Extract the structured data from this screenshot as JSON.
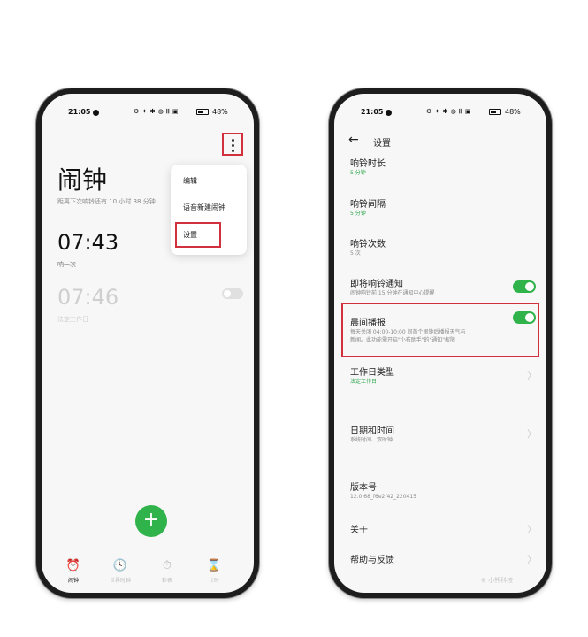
{
  "status_bar": {
    "time": "21:05",
    "icons": "⚙ ✦ ✱ ◍ 𝄃𝄃 ▣",
    "battery": "48%"
  },
  "clock_screen": {
    "title": "闹钟",
    "next_alarm": "距离下次响铃还有 10 小时 38 分钟",
    "alarms": [
      {
        "time": "07:43",
        "label": "响一次",
        "enabled": true
      },
      {
        "time": "07:46",
        "label": "法定工作日",
        "enabled": false
      }
    ],
    "menu": {
      "items": [
        "编辑",
        "语音新建闹钟",
        "设置"
      ]
    },
    "add_button": "+",
    "tabs": [
      {
        "icon": "⏰",
        "label": "闹钟",
        "active": true
      },
      {
        "icon": "🕓",
        "label": "世界时钟",
        "active": false
      },
      {
        "icon": "⏱",
        "label": "秒表",
        "active": false
      },
      {
        "icon": "⌛",
        "label": "计时",
        "active": false
      }
    ]
  },
  "settings_screen": {
    "title": "设置",
    "rows": [
      {
        "title": "响铃时长",
        "sub": "5 分钟"
      },
      {
        "title": "响铃间隔",
        "sub": "5 分钟"
      },
      {
        "title": "响铃次数",
        "sub": "5 次"
      },
      {
        "title": "即将响铃通知",
        "sub": "闹钟响铃前 15 分钟在通知中心提醒",
        "toggle": true
      },
      {
        "title": "晨间播报",
        "sub_line1": "每天关闭 04:00-10:00 间首个闹钟后播报天气与",
        "sub_line2": "新闻。此功能需开启\"小布助手\"的\"通知\"权限",
        "toggle": true
      },
      {
        "title": "工作日类型",
        "sub": "法定工作日"
      },
      {
        "title": "日期和时间",
        "sub": "系统时间、双时钟"
      },
      {
        "title": "版本号",
        "sub": "12.0.68_f6e2f42_220415"
      },
      {
        "title": "关于"
      },
      {
        "title": "帮助与反馈"
      }
    ],
    "watermark": "⊕ 小熊科技"
  }
}
